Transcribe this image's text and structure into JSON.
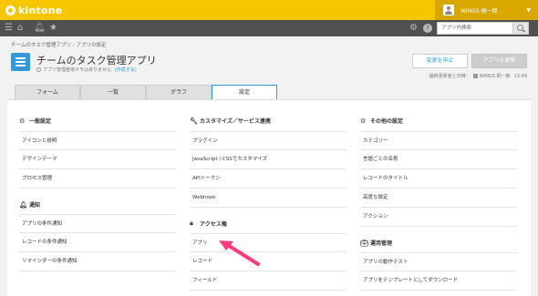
{
  "brand": {
    "name": "kintone"
  },
  "user": {
    "name": "WINGS 桐一郎"
  },
  "search": {
    "placeholder": "アプリ内検索"
  },
  "breadcrumb": "チームのタスク管理アプリ  ›  アプリの設定",
  "app": {
    "title": "チームのタスク管理アプリ",
    "meta_text": "アプリ管理者用メモはありません",
    "meta_link": "(作成する)"
  },
  "actions": {
    "cancel_label": "変更を中止",
    "update_label": "アプリを更新"
  },
  "last_updated": {
    "label": "最終更新者と日時：",
    "user": "WINGS 桐一郎",
    "time": "13:49"
  },
  "tabs": [
    "フォーム",
    "一覧",
    "グラフ",
    "設定"
  ],
  "columns": [
    {
      "sections": [
        {
          "title": "一般設定",
          "icon": "gear-icon",
          "items": [
            "アイコンと説明",
            "デザインテーマ",
            "プロセス管理"
          ]
        },
        {
          "title": "通知",
          "icon": "bell-icon",
          "items": [
            "アプリの条件通知",
            "レコードの条件通知",
            "リマインダーの条件通知"
          ]
        }
      ]
    },
    {
      "sections": [
        {
          "title": "カスタマイズ／サービス連携",
          "icon": "wrench-icon",
          "items": [
            "プラグイン",
            "JavaScript / CSSでカスタマイズ",
            "APIトークン",
            "Webhook"
          ]
        },
        {
          "title": "アクセス権",
          "icon": "lock-icon",
          "items": [
            "アプリ",
            "レコード",
            "フィールド"
          ]
        }
      ]
    },
    {
      "sections": [
        {
          "title": "その他の設定",
          "icon": "gears-icon",
          "items": [
            "カテゴリー",
            "言語ごとの名称",
            "レコードのタイトル",
            "高度な設定",
            "アクション"
          ]
        },
        {
          "title": "運用管理",
          "icon": "briefcase-icon",
          "items": [
            "アプリの動作テスト",
            "アプリをテンプレートとしてダウンロード"
          ]
        }
      ]
    }
  ],
  "colors": {
    "header": "#f6c700",
    "nav": "#505050",
    "accent": "#3498db",
    "arrow": "#ff3a7a"
  }
}
